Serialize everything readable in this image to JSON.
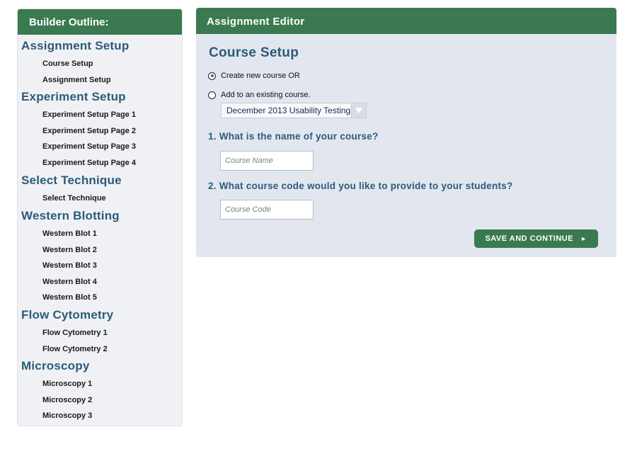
{
  "sidebar": {
    "title": "Builder Outline:",
    "sections": [
      {
        "title": "Assignment Setup",
        "items": [
          "Course Setup",
          "Assignment Setup"
        ]
      },
      {
        "title": "Experiment Setup",
        "items": [
          "Experiment Setup Page 1",
          "Experiment Setup Page 2",
          "Experiment Setup Page 3",
          "Experiment Setup Page 4"
        ]
      },
      {
        "title": "Select Technique",
        "items": [
          "Select Technique"
        ]
      },
      {
        "title": "Western Blotting",
        "items": [
          "Western Blot 1",
          "Western Blot 2",
          "Western Blot 3",
          "Western Blot 4",
          "Western Blot 5"
        ]
      },
      {
        "title": "Flow Cytometry",
        "items": [
          "Flow Cytometry 1",
          "Flow Cytometry 2"
        ]
      },
      {
        "title": "Microscopy",
        "items": [
          "Microscopy 1",
          "Microscopy 2",
          "Microscopy 3"
        ]
      }
    ]
  },
  "editor": {
    "title": "Assignment Editor",
    "section_title": "Course Setup",
    "radio_new_label": "Create new course OR",
    "radio_existing_label": "Add to an existing course.",
    "selected_option": "new",
    "course_select_value": "December 2013 Usability Testing",
    "question1": "1. What is the name of your course?",
    "course_name_placeholder": "Course Name",
    "question2": "2. What course code would you like to provide to your students?",
    "course_code_placeholder": "Course Code",
    "save_button_label": "SAVE AND CONTINUE",
    "save_button_arrow": "►"
  },
  "colors": {
    "header_green": "#3b7a51",
    "title_blue": "#2c5b7a"
  }
}
